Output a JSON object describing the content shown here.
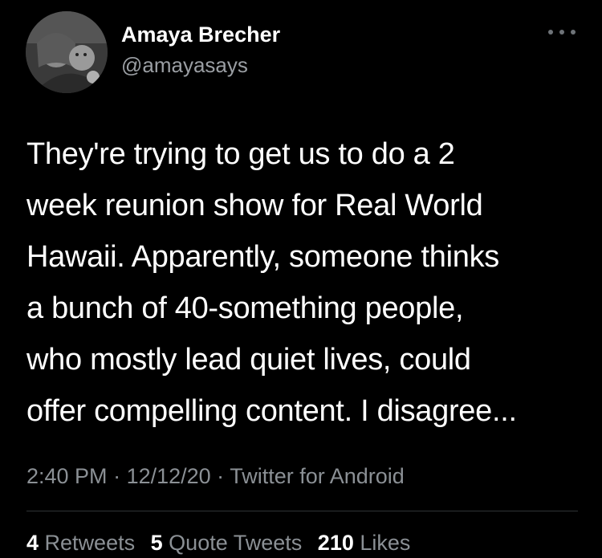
{
  "author": {
    "display_name": "Amaya Brecher",
    "handle": "@amayasays",
    "avatar_icon": "profile-photo"
  },
  "more_icon": "more-horizontal-icon",
  "tweet": {
    "lines": [
      "They're trying to get us to do a 2",
      "week reunion show for Real World",
      "Hawaii. Apparently, someone thinks",
      "a bunch of 40-something people,",
      "who mostly lead quiet lives, could",
      "offer compelling content. I disagree..."
    ]
  },
  "meta": {
    "time": "2:40 PM",
    "sep1": " · ",
    "date": "12/12/20",
    "sep2": " · ",
    "source": "Twitter for Android"
  },
  "stats": {
    "retweets_count": "4",
    "retweets_label": "Retweets",
    "quotes_count": "5",
    "quotes_label": "Quote Tweets",
    "likes_count": "210",
    "likes_label": "Likes"
  },
  "colors": {
    "background": "#000000",
    "primary_text": "#ffffff",
    "secondary_text": "#8b9095",
    "divider": "#2f3336"
  }
}
